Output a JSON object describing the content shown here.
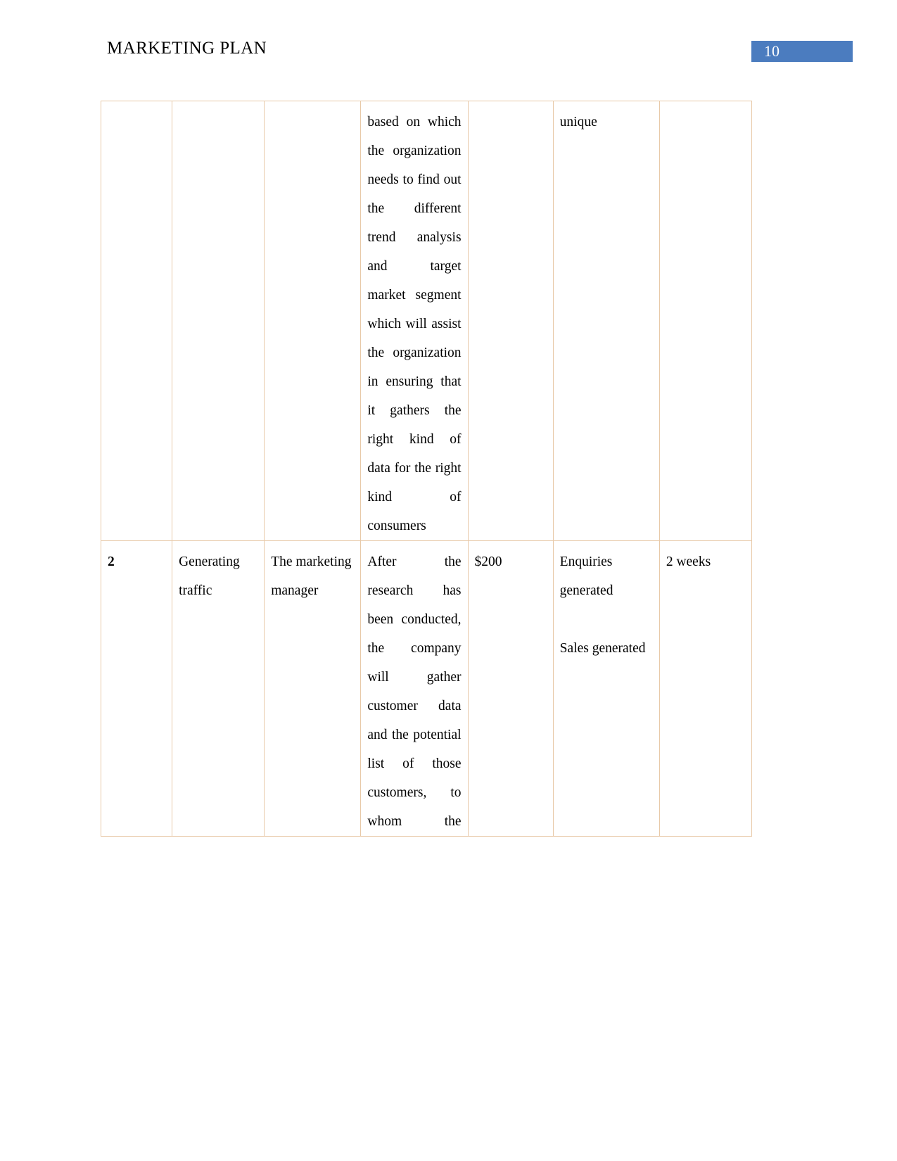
{
  "document": {
    "header": {
      "title": "MARKETING PLAN",
      "page_number": "10",
      "banner_color": "#4B7CBF"
    },
    "table": {
      "border_color": "#E8C9A8",
      "rows": [
        {
          "name": "continued-row",
          "cells": {
            "no": "",
            "activity": "",
            "responsible": "",
            "description": "based on which the organization needs to find out the different trend analysis and target market segment which will assist the organization in ensuring that it gathers the right kind of data for the right kind of consumers",
            "budget": "",
            "measure": "unique",
            "timeline": ""
          }
        },
        {
          "name": "row-2",
          "cells": {
            "no": "2",
            "activity": "Generating traffic",
            "responsible": "The marketing manager",
            "description": "After the research has been conducted, the company will gather customer data and the potential list of those customers, to whom the",
            "budget": "$200",
            "measure_1": "Enquiries generated",
            "measure_2": "Sales generated",
            "timeline": "2 weeks"
          }
        }
      ]
    }
  }
}
